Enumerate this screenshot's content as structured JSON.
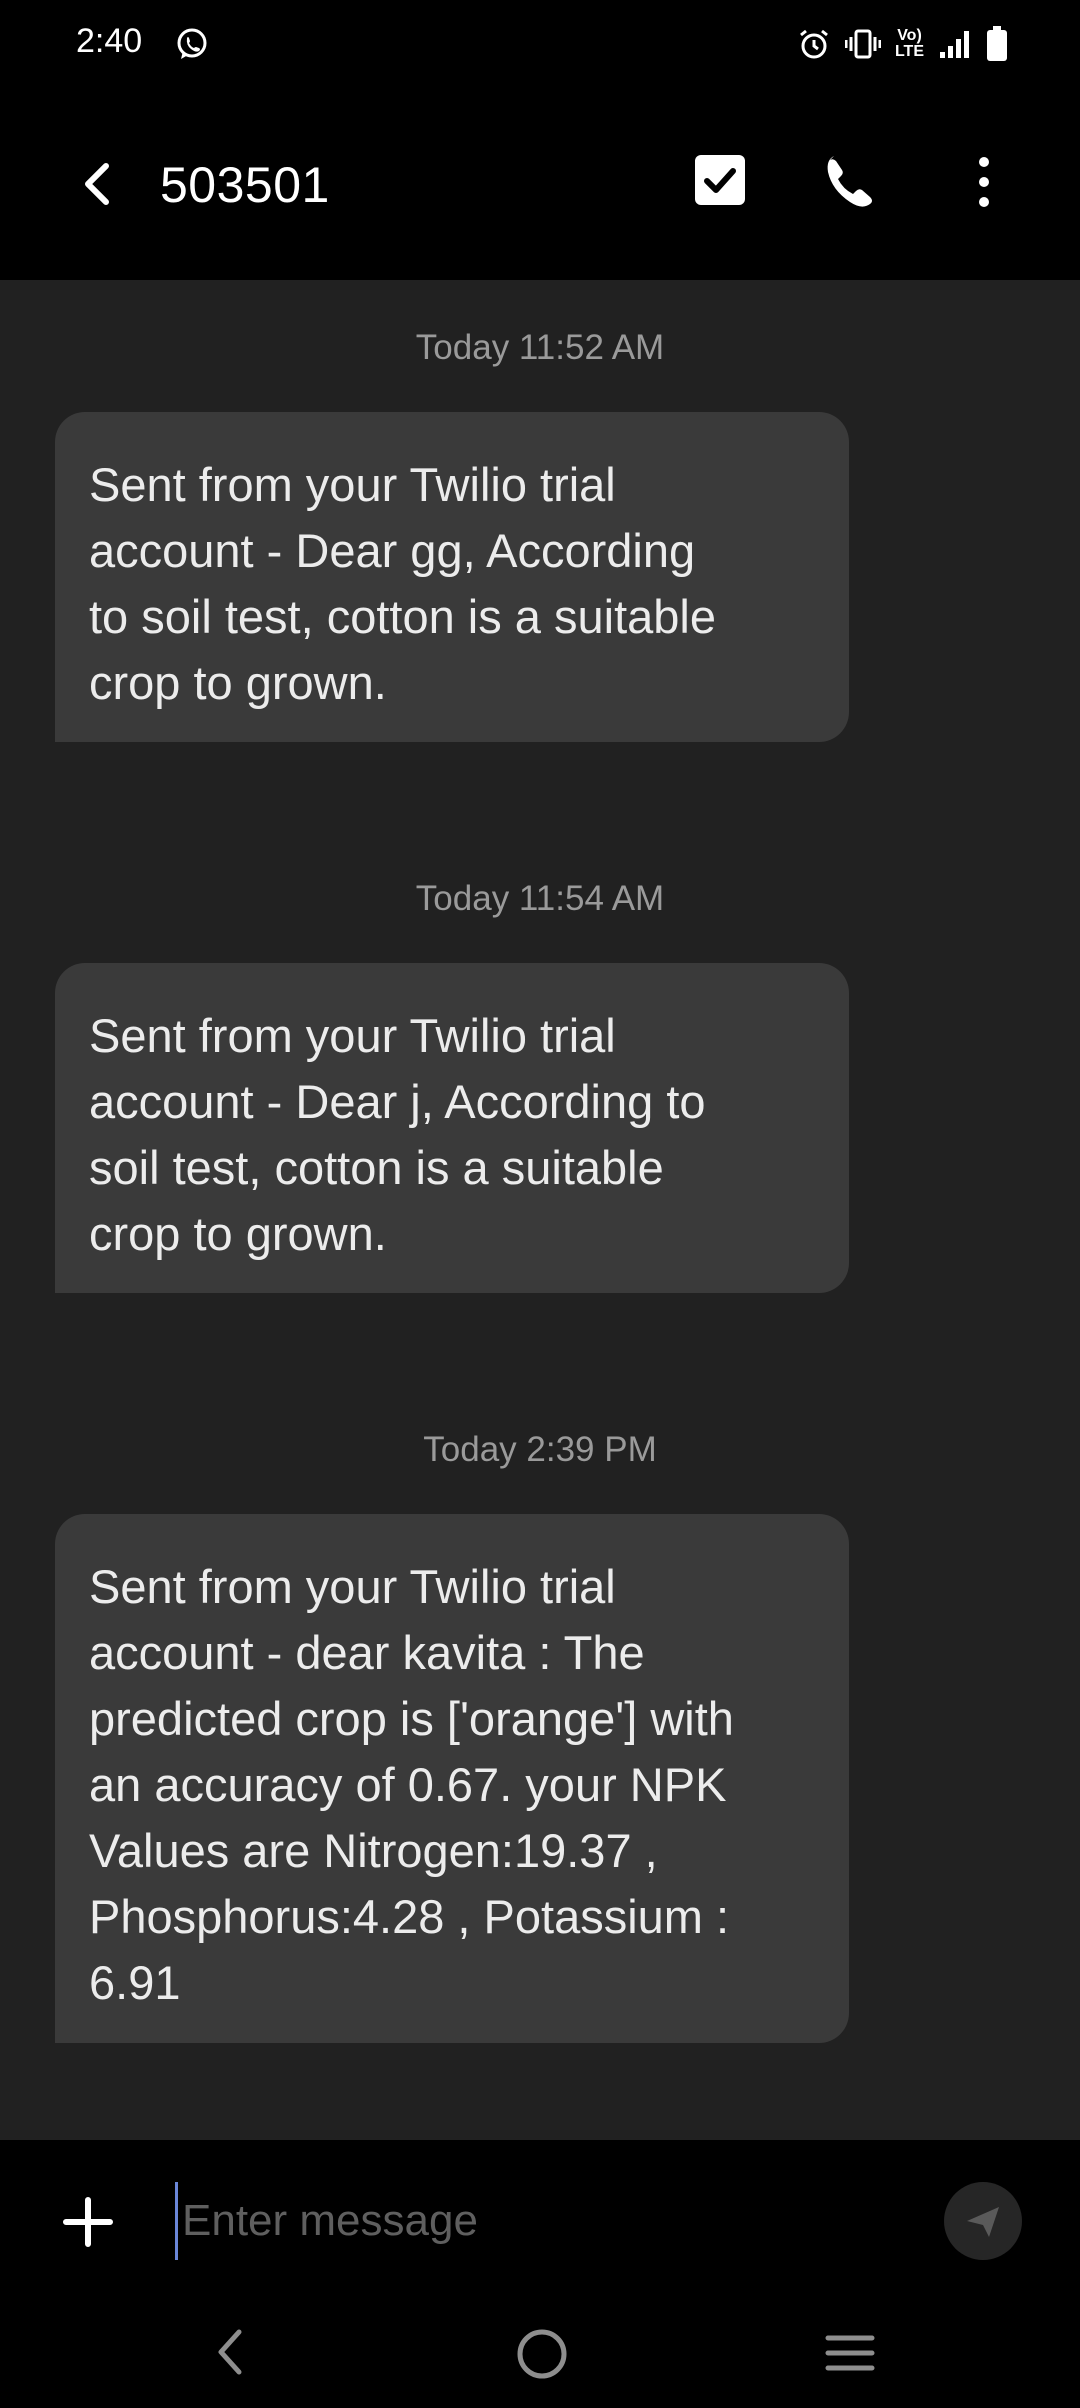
{
  "status_bar": {
    "time": "2:40",
    "icons": [
      "whatsapp-icon",
      "alarm-icon",
      "vibrate-icon",
      "volte-icon",
      "signal-icon",
      "battery-icon"
    ],
    "volte_line1": "Vo)",
    "volte_line2": "LTE"
  },
  "app_bar": {
    "title": "503501",
    "icons": [
      "back-arrow-icon",
      "checkbox-icon",
      "phone-icon",
      "more-vertical-icon"
    ]
  },
  "conversation": {
    "messages": [
      {
        "timestamp": "Today 11:52 AM",
        "text": "Sent from your Twilio trial\naccount - Dear gg, According\nto soil test, cotton is a suitable\ncrop to grown."
      },
      {
        "timestamp": "Today 11:54 AM",
        "text": "Sent from your Twilio trial\naccount - Dear j, According to\nsoil test, cotton is a suitable\ncrop to grown."
      },
      {
        "timestamp": "Today 2:39 PM",
        "text": "Sent from your Twilio trial\naccount - dear kavita : The\npredicted crop is ['orange'] with\nan accuracy of 0.67. your NPK\nValues are Nitrogen:19.37 ,\nPhosphorus:4.28 , Potassium :\n6.91"
      }
    ]
  },
  "composer": {
    "placeholder": "Enter message",
    "value": "",
    "icons": [
      "plus-icon",
      "send-icon"
    ]
  },
  "nav_bar": {
    "icons": [
      "nav-back-icon",
      "nav-home-icon",
      "nav-recents-icon"
    ]
  },
  "colors": {
    "background": "#000000",
    "conversation_bg": "#212121",
    "bubble_bg": "#3a3a3a",
    "timestamp": "#9a9a9a",
    "cursor": "#6a86d8"
  }
}
